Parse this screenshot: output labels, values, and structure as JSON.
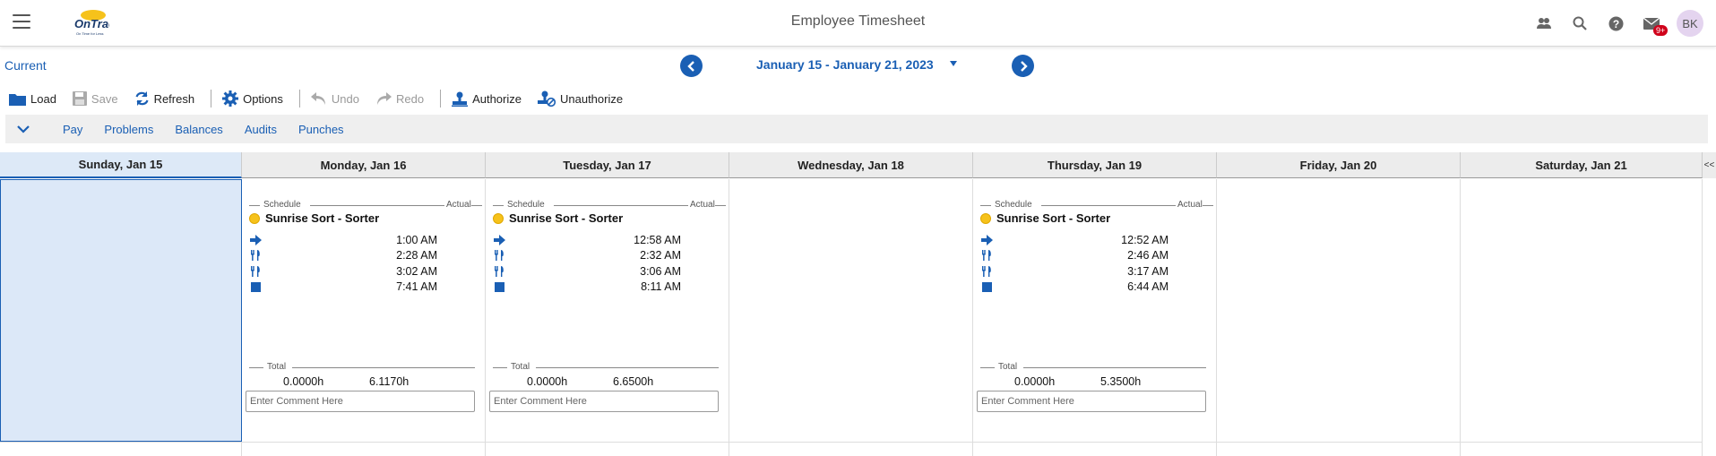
{
  "app": {
    "title": "Employee Timesheet",
    "avatar_initials": "BK",
    "mail_badge": "9+",
    "logo_text": "OnTrac",
    "logo_tagline": "On Time for Less"
  },
  "nav": {
    "current_label": "Current",
    "date_range": "January 15 - January 21, 2023"
  },
  "toolbar": {
    "load": "Load",
    "save": "Save",
    "refresh": "Refresh",
    "options": "Options",
    "undo": "Undo",
    "redo": "Redo",
    "authorize": "Authorize",
    "unauthorize": "Unauthorize"
  },
  "tabs": [
    "Pay",
    "Problems",
    "Balances",
    "Audits",
    "Punches"
  ],
  "collapse_label": "<<",
  "days": [
    {
      "label": "Sunday, Jan 15",
      "selected": true,
      "card": null
    },
    {
      "label": "Monday, Jan 16",
      "selected": false,
      "card": {
        "schedule_label": "Schedule",
        "actual_label": "Actual",
        "shift": "Sunrise Sort - Sorter",
        "punches": [
          "1:00 AM",
          "2:28 AM",
          "3:02 AM",
          "7:41 AM"
        ],
        "total_label": "Total",
        "total_scheduled": "0.0000h",
        "total_actual": "6.1170h",
        "comment_placeholder": "Enter Comment Here"
      }
    },
    {
      "label": "Tuesday, Jan 17",
      "selected": false,
      "card": {
        "schedule_label": "Schedule",
        "actual_label": "Actual",
        "shift": "Sunrise Sort - Sorter",
        "punches": [
          "12:58 AM",
          "2:32 AM",
          "3:06 AM",
          "8:11 AM"
        ],
        "total_label": "Total",
        "total_scheduled": "0.0000h",
        "total_actual": "6.6500h",
        "comment_placeholder": "Enter Comment Here"
      }
    },
    {
      "label": "Wednesday, Jan 18",
      "selected": false,
      "card": null
    },
    {
      "label": "Thursday, Jan 19",
      "selected": false,
      "card": {
        "schedule_label": "Schedule",
        "actual_label": "Actual",
        "shift": "Sunrise Sort - Sorter",
        "punches": [
          "12:52 AM",
          "2:46 AM",
          "3:17 AM",
          "6:44 AM"
        ],
        "total_label": "Total",
        "total_scheduled": "0.0000h",
        "total_actual": "5.3500h",
        "comment_placeholder": "Enter Comment Here"
      }
    },
    {
      "label": "Friday, Jan 20",
      "selected": false,
      "card": null
    },
    {
      "label": "Saturday, Jan 21",
      "selected": false,
      "card": null
    }
  ],
  "punch_types": [
    "punch-in-icon",
    "meal-start-icon",
    "meal-end-icon",
    "punch-out-icon"
  ],
  "colors": {
    "accent": "#1a5fb4",
    "selected_day_bg": "#dce8f8",
    "shift_dot": "#f6c21b",
    "badge": "#d0021b"
  }
}
